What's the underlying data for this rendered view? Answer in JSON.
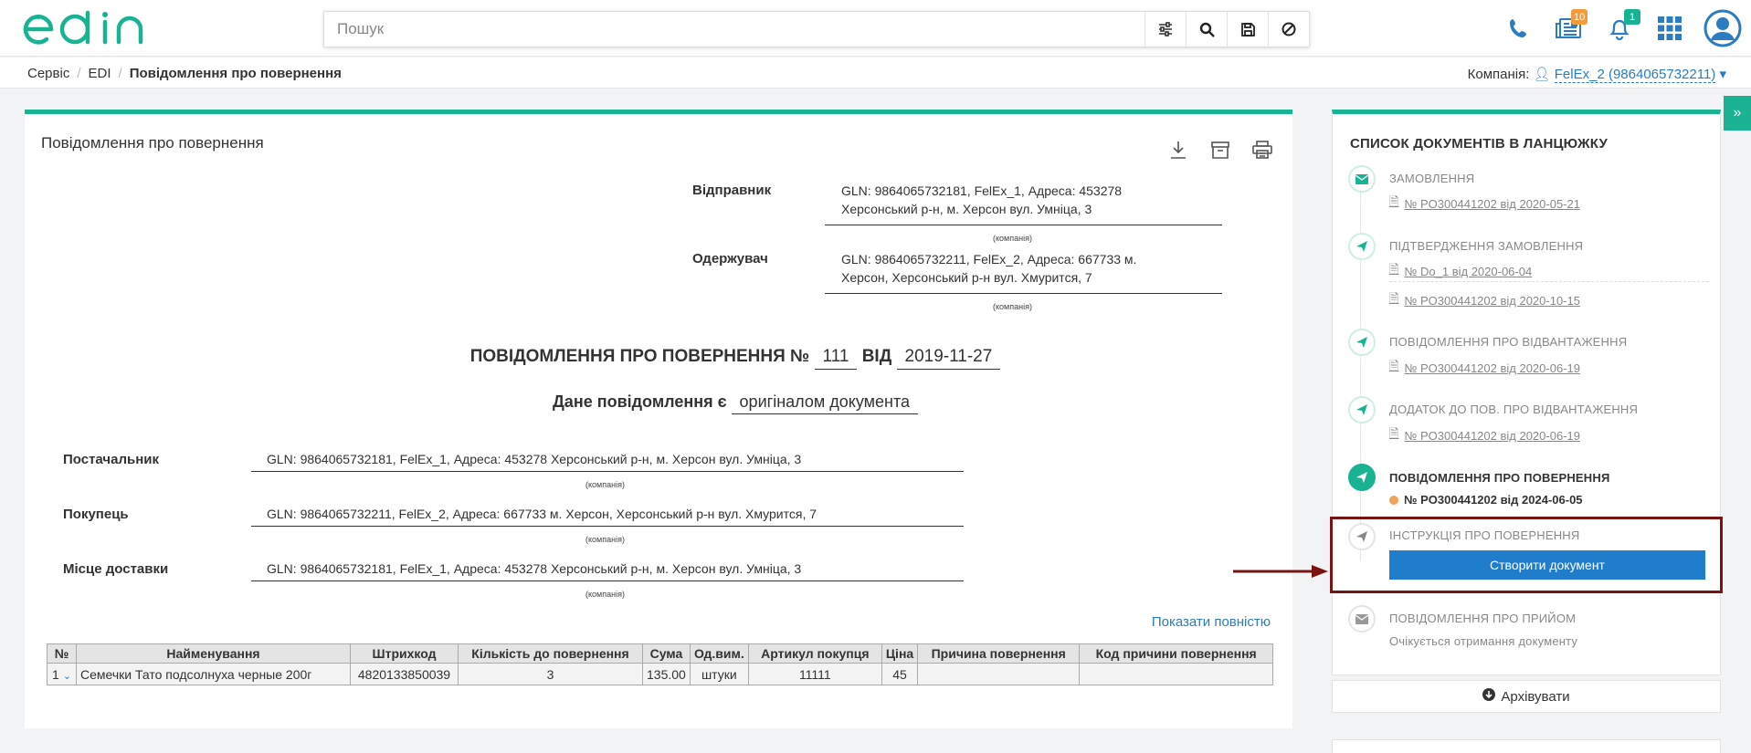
{
  "header": {
    "search_placeholder": "Пошук",
    "badges": {
      "docs": "10",
      "notifications": "1"
    },
    "accent": "#19b394",
    "badge_orange": "#f39c3c",
    "badge_green": "#19b394"
  },
  "breadcrumb": {
    "items": [
      "Сервіс",
      "EDI",
      "Повідомлення про повернення"
    ]
  },
  "company": {
    "label": "Компанія:",
    "value": "FelEx_2 (9864065732211)"
  },
  "document": {
    "title": "Повідомлення про повернення",
    "sender_label": "Відправник",
    "sender_line1": "GLN: 9864065732181, FelEx_1, Адреса: 453278",
    "sender_line2": "Херсонський р-н, м. Херсон вул. Умніца, 3",
    "receiver_label": "Одержувач",
    "receiver_line1": "GLN: 9864065732211, FelEx_2, Адреса: 667733 м.",
    "receiver_line2": "Херсон, Херсонський р-н вул. Хмурится, 7",
    "company_caption": "(компанія)",
    "notice_prefix": "ПОВІДОМЛЕННЯ ПРО ПОВЕРНЕННЯ №",
    "number": "111",
    "date_prefix": "ВІД",
    "date": "2019-11-27",
    "original_prefix": "Дане повідомлення є",
    "original_value": "оригіналом документа",
    "supplier_label": "Постачальник",
    "supplier_value": "GLN: 9864065732181, FelEx_1, Адреса: 453278 Херсонський р-н, м. Херсон вул. Умніца, 3",
    "buyer_label": "Покупець",
    "buyer_value": "GLN: 9864065732211, FelEx_2, Адреса: 667733 м. Херсон, Херсонський р-н вул. Хмурится, 7",
    "delivery_label": "Місце доставки",
    "delivery_value": "GLN: 9864065732181, FelEx_1, Адреса: 453278 Херсонський р-н, м. Херсон вул. Умніца, 3",
    "show_all": "Показати повністю"
  },
  "table": {
    "headers": [
      "№",
      "Найменування",
      "Штрихкод",
      "Кількість до повернення",
      "Сума",
      "Од.вим.",
      "Артикул покупця",
      "Ціна",
      "Причина повернення",
      "Код причини повернення"
    ],
    "rows": [
      [
        "1",
        "Семечки Тато подсолнуха черные 200г",
        "4820133850039",
        "3",
        "135.00",
        "штуки",
        "11111",
        "45",
        "",
        ""
      ]
    ]
  },
  "chain": {
    "title": "СПИСОК ДОКУМЕНТІВ В ЛАНЦЮЖКУ",
    "steps": [
      {
        "title": "ЗАМОВЛЕННЯ",
        "links": [
          "№ PO300441202 від 2020-05-21"
        ]
      },
      {
        "title": "ПІДТВЕРДЖЕННЯ ЗАМОВЛЕННЯ",
        "links": [
          "№ Do_1 від 2020-06-04",
          "№ PO300441202 від 2020-10-15"
        ]
      },
      {
        "title": "ПОВІДОМЛЕННЯ ПРО ВІДВАНТАЖЕННЯ",
        "links": [
          "№ PO300441202 від 2020-06-19"
        ]
      },
      {
        "title": "ДОДАТОК ДО ПОВ. ПРО ВІДВАНТАЖЕННЯ",
        "links": [
          "№ PO300441202 від 2020-06-19"
        ]
      },
      {
        "title": "ПОВІДОМЛЕННЯ ПРО ПОВЕРНЕННЯ",
        "links": [
          "№ PO300441202 від 2024-06-05"
        ]
      },
      {
        "title": "ІНСТРУКЦІЯ ПРО ПОВЕРНЕННЯ",
        "links": []
      },
      {
        "title": "ПОВІДОМЛЕННЯ ПРО ПРИЙОМ",
        "links": [],
        "note": "Очікується отримання документу"
      }
    ],
    "create_button": "Створити документ",
    "archive_button": "Архівувати"
  }
}
